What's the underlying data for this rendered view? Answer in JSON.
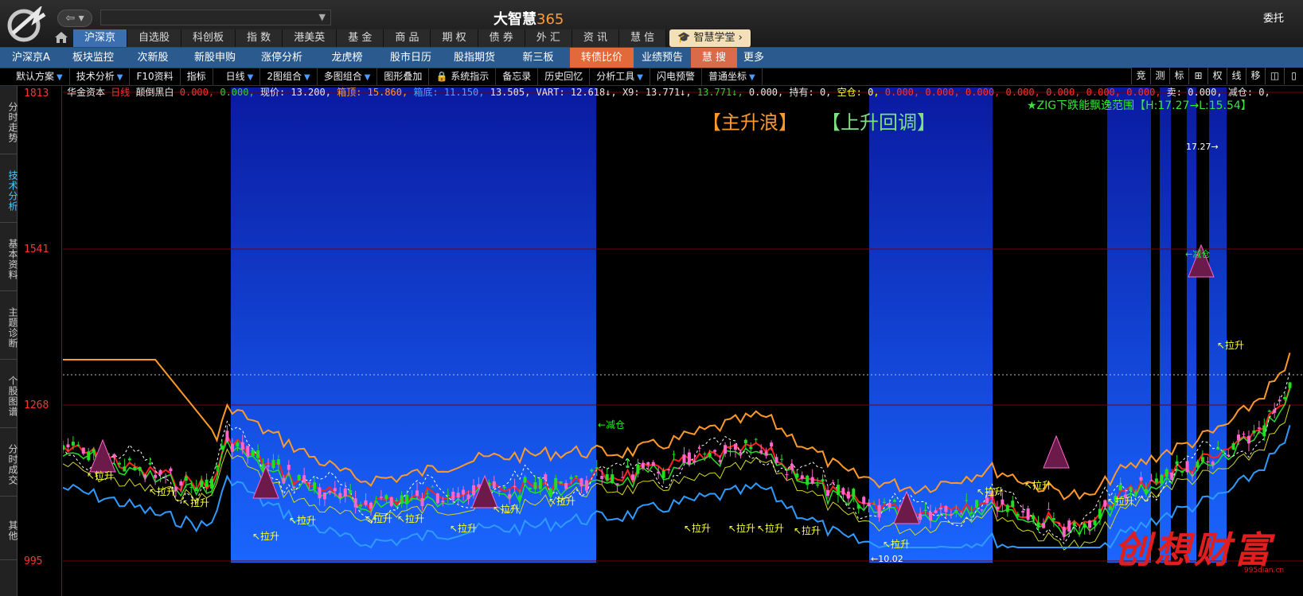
{
  "app": {
    "title_text": "大智慧",
    "title_num": "365",
    "right_link": "委托"
  },
  "top_nav": [
    "沪深京",
    "自选股",
    "科创板",
    "指 数",
    "港美英",
    "基 金",
    "商 品",
    "期 权",
    "债 券",
    "外 汇",
    "资 讯",
    "慧 信"
  ],
  "edu_button": "智慧学堂",
  "sec_nav": [
    "沪深京A",
    "板块监控",
    "次新股",
    "新股申购",
    "涨停分析",
    "龙虎榜",
    "股市日历",
    "股指期货",
    "新三板",
    "转债比价",
    "业绩预告",
    "慧 搜",
    "更多"
  ],
  "toolbar": [
    "默认方案",
    "技术分析",
    "F10资料",
    "指标",
    "日线",
    "2图组合",
    "多图组合",
    "图形叠加",
    "系统指示",
    "备忘录",
    "历史回忆",
    "分析工具",
    "闪电预警",
    "普通坐标"
  ],
  "tool_icons": [
    "竞",
    "测",
    "标",
    "⊞",
    "权",
    "线",
    "移",
    "◫",
    "▯"
  ],
  "sidebar_tabs": [
    "分时走势",
    "技术分析",
    "基本资料",
    "主题诊断",
    "个股图谱",
    "分时成交",
    "其他"
  ],
  "y_axis": [
    "1813",
    "1541",
    "1268",
    "995"
  ],
  "info": {
    "stock": "华金资本",
    "period": "日线",
    "indicator": "颠倒黑白",
    "v1": "0.000,",
    "v2": "0.000,",
    "price_label": "现价: 13.200,",
    "box_top_label": "箱顶: 15.860,",
    "box_bottom_label": "箱底: 11.150,",
    "mid_value": "13.505,",
    "vart": "VART: 12.618↓,",
    "x9": "X9: 13.771↓,",
    "x9b": "13.771↓,",
    "x10": "0.000,",
    "hold": "持有: 0,",
    "empty_pos": "空仓: 0,",
    "zeros": "0.000, 0.000, 0.000, 0.000, 0.000, 0.000, 0.000,",
    "sell": "卖: 0.000,",
    "reduce": "减仓: 0,"
  },
  "chart_labels": {
    "zig": "★ZIG下跌能飘逸范围【H:17.27→L:15.54】",
    "main_wave": "【主升浪】",
    "pullback": "【上升回调】",
    "high_tag": "17.27",
    "low_tag": "10.02",
    "lashng": "拉升",
    "jiancang": "减仓"
  },
  "watermark": {
    "text": "创想财富",
    "url": "995dian.cn"
  },
  "colors": {
    "accent_blue": "#2b5a8e",
    "active_tab": "#3b6fb0",
    "hl_orange": "#e26a3a",
    "axis_red": "#ff3333"
  }
}
